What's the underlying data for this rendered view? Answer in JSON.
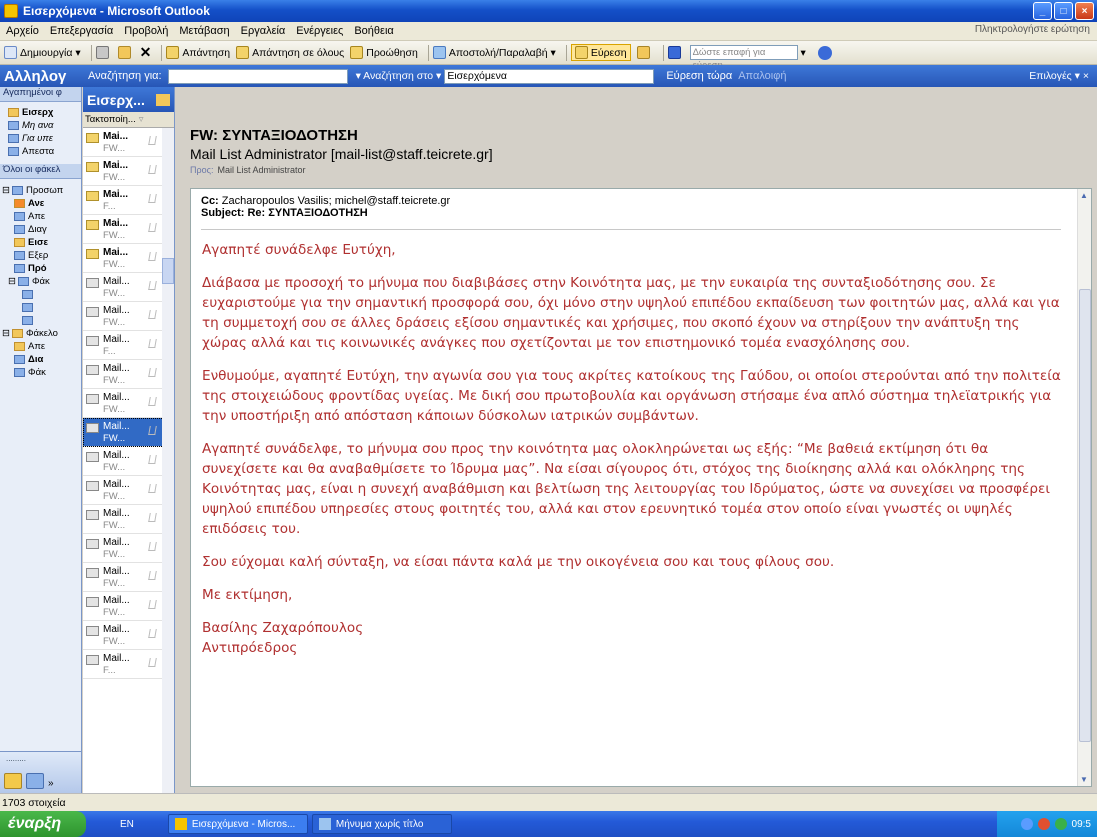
{
  "window": {
    "title": "Εισερχόμενα - Microsoft Outlook"
  },
  "menu": {
    "items": [
      "Αρχείο",
      "Επεξεργασία",
      "Προβολή",
      "Μετάβαση",
      "Εργαλεία",
      "Ενέργειες",
      "Βοήθεια"
    ],
    "help_placeholder": "Πληκτρολογήστε ερώτηση"
  },
  "toolbar": {
    "new": "Δημιουργία",
    "reply": "Απάντηση",
    "reply_all": "Απάντηση σε όλους",
    "forward": "Προώθηση",
    "send_receive": "Αποστολή/Παραλαβή",
    "find": "Εύρεση",
    "search_placeholder": "Δώστε επαφή για εύρεση"
  },
  "findbar": {
    "nav_title": "Αλληλογ",
    "search_for": "Αναζήτηση για:",
    "search_in": "Αναζήτηση στο",
    "search_in_value": "Εισερχόμενα",
    "find_now": "Εύρεση τώρα",
    "clear": "Απαλοιφή",
    "options": "Επιλογές"
  },
  "nav": {
    "favorites": "Αγαπημένοι φ",
    "fav_items": [
      "Εισερχ",
      "Μη ανα",
      "Για υπε",
      "Απεστα"
    ],
    "all_folders": "Όλοι οι φάκελ",
    "tree": [
      "Προσωπ",
      "Ανε",
      "Απε",
      "Διαγ",
      "Εισε",
      "Εξερ",
      "Πρό",
      "Φάκ",
      "Φάκελο",
      "Απε",
      "Δια",
      "Φάκ"
    ],
    "pager": "........."
  },
  "list": {
    "header": "Εισερχ...",
    "arrange": "Τακτοποίη...",
    "items": [
      {
        "from": "Mai...",
        "subj": "FW...",
        "unread": true
      },
      {
        "from": "Mai...",
        "subj": "FW...",
        "unread": true
      },
      {
        "from": "Mai...",
        "subj": "F...",
        "unread": true
      },
      {
        "from": "Mai...",
        "subj": "FW...",
        "unread": true
      },
      {
        "from": "Mai...",
        "subj": "FW...",
        "unread": true
      },
      {
        "from": "Mail...",
        "subj": "FW...",
        "unread": false
      },
      {
        "from": "Mail...",
        "subj": "FW...",
        "unread": false
      },
      {
        "from": "Mail...",
        "subj": "F...",
        "unread": false
      },
      {
        "from": "Mail...",
        "subj": "FW...",
        "unread": false
      },
      {
        "from": "Mail...",
        "subj": "FW...",
        "unread": false
      },
      {
        "from": "Mail...",
        "subj": "FW...",
        "unread": false,
        "selected": true
      },
      {
        "from": "Mail...",
        "subj": "FW...",
        "unread": false
      },
      {
        "from": "Mail...",
        "subj": "FW...",
        "unread": false
      },
      {
        "from": "Mail...",
        "subj": "FW...",
        "unread": false
      },
      {
        "from": "Mail...",
        "subj": "FW...",
        "unread": false
      },
      {
        "from": "Mail...",
        "subj": "FW...",
        "unread": false
      },
      {
        "from": "Mail...",
        "subj": "FW...",
        "unread": false
      },
      {
        "from": "Mail...",
        "subj": "FW...",
        "unread": false
      },
      {
        "from": "Mail...",
        "subj": "F...",
        "unread": false
      }
    ]
  },
  "message": {
    "subject": "FW: ΣΥΝΤΑΞΙΟΔΟΤΗΣΗ",
    "sender": "Mail List Administrator [mail-list@staff.teicrete.gr]",
    "to_label": "Προς:",
    "to_value": "Mail List Administrator",
    "cc_label": "Cc:",
    "cc_value": "Zacharopoulos Vasilis; michel@staff.teicrete.gr",
    "subject_label": "Subject:",
    "subject_value": "Re: ΣΥΝΤΑΞΙΟΔΟΤΗΣΗ",
    "greeting": "Αγαπητέ συνάδελφε Ευτύχη,",
    "p1": "Διάβασα με προσοχή το μήνυμα που διαβιβάσες στην Κοινότητα μας, με την ευκαιρία της συνταξιοδότησης σου. Σε ευχαριστούμε για την σημαντική προσφορά σου, όχι μόνο στην υψηλού επιπέδου εκπαίδευση των φοιτητών μας, αλλά και για τη συμμετοχή σου σε άλλες δράσεις εξίσου σημαντικές και χρήσιμες, που σκοπό έχουν να στηρίξουν την ανάπτυξη της χώρας αλλά και τις κοινωνικές ανάγκες που σχετίζονται με τον επιστημονικό τομέα ενασχόλησης σου.",
    "p2": "Ενθυμούμε, αγαπητέ Ευτύχη, την αγωνία σου για τους ακρίτες κατοίκους της Γαύδου, οι οποίοι στερούνται από την πολιτεία της στοιχειώδους φροντίδας υγείας. Με δική σου πρωτοβουλία και οργάνωση στήσαμε ένα απλό σύστημα τηλεϊατρικής για την υποστήριξη από απόσταση κάποιων δύσκολων ιατρικών συμβάντων.",
    "p3": "Αγαπητέ συνάδελφε, το μήνυμα σου προς την κοινότητα μας ολοκληρώνεται ως εξής: “Με βαθειά εκτίμηση ότι θα συνεχίσετε και θα αναβαθμίσετε το Ίδρυμα μας”. Να είσαι σίγουρος ότι, στόχος της διοίκησης αλλά και ολόκληρης της Κοινότητας μας, είναι η συνεχή αναβάθμιση και βελτίωση της λειτουργίας του Ιδρύματος, ώστε να συνεχίσει να προσφέρει υψηλού επιπέδου υπηρεσίες στους φοιτητές του, αλλά και στον ερευνητικό τομέα στον οποίο είναι γνωστές οι υψηλές επιδόσεις του.",
    "p4": "Σου εύχομαι καλή σύνταξη, να είσαι πάντα καλά με την οικογένεια σου και τους φίλους σου.",
    "closing": "Με εκτίμηση,",
    "sig_name": "Βασίλης Ζαχαρόπουλος",
    "sig_title": "Αντιπρόεδρος"
  },
  "status": {
    "count": "1703 στοιχεία"
  },
  "taskbar": {
    "start": "έναρξη",
    "lang": "EN",
    "tasks": [
      "Εισερχόμενα - Micros...",
      "Μήνυμα χωρίς τίτλο"
    ],
    "clock": "09:5"
  }
}
